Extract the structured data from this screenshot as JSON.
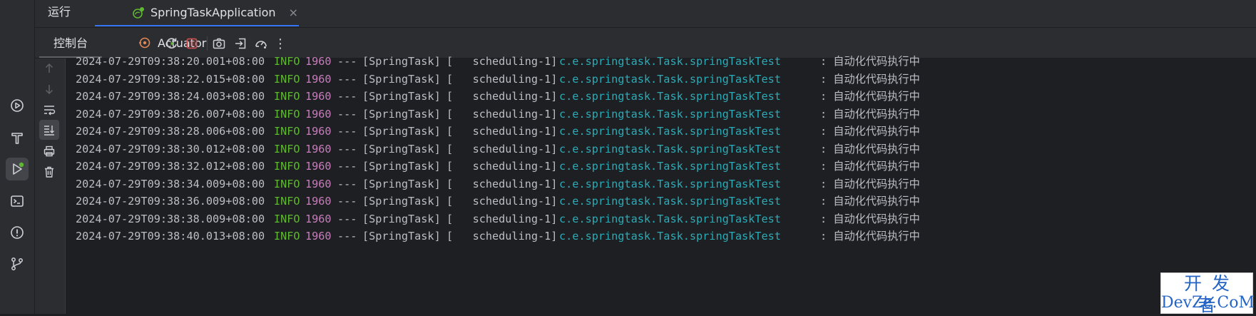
{
  "header": {
    "run_label": "运行",
    "app_tab": {
      "label": "SpringTaskApplication",
      "close": "×"
    }
  },
  "toolbar": {
    "console_tab": "控制台",
    "actuator_tab": "Actuator",
    "more": "⋮"
  },
  "left_strip_icons": [
    "services-icon",
    "build-icon",
    "run-icon",
    "terminal-icon",
    "problems-icon",
    "git-icon"
  ],
  "gutter_icons": [
    "scroll-up-icon",
    "scroll-down-icon",
    "soft-wrap-icon",
    "scroll-to-end-icon",
    "print-icon",
    "clear-icon"
  ],
  "console": {
    "lines": [
      {
        "ts": "2024-07-29T09:38:20.001+08:00",
        "level": "INFO",
        "pid": "1960",
        "sep": "---",
        "app": "[SpringTask]",
        "thread": "[   scheduling-1]",
        "logger": "c.e.springtask.Task.springTaskTest",
        "msg": ": 自动化代码执行中"
      },
      {
        "ts": "2024-07-29T09:38:22.015+08:00",
        "level": "INFO",
        "pid": "1960",
        "sep": "---",
        "app": "[SpringTask]",
        "thread": "[   scheduling-1]",
        "logger": "c.e.springtask.Task.springTaskTest",
        "msg": ": 自动化代码执行中"
      },
      {
        "ts": "2024-07-29T09:38:24.003+08:00",
        "level": "INFO",
        "pid": "1960",
        "sep": "---",
        "app": "[SpringTask]",
        "thread": "[   scheduling-1]",
        "logger": "c.e.springtask.Task.springTaskTest",
        "msg": ": 自动化代码执行中"
      },
      {
        "ts": "2024-07-29T09:38:26.007+08:00",
        "level": "INFO",
        "pid": "1960",
        "sep": "---",
        "app": "[SpringTask]",
        "thread": "[   scheduling-1]",
        "logger": "c.e.springtask.Task.springTaskTest",
        "msg": ": 自动化代码执行中"
      },
      {
        "ts": "2024-07-29T09:38:28.006+08:00",
        "level": "INFO",
        "pid": "1960",
        "sep": "---",
        "app": "[SpringTask]",
        "thread": "[   scheduling-1]",
        "logger": "c.e.springtask.Task.springTaskTest",
        "msg": ": 自动化代码执行中"
      },
      {
        "ts": "2024-07-29T09:38:30.012+08:00",
        "level": "INFO",
        "pid": "1960",
        "sep": "---",
        "app": "[SpringTask]",
        "thread": "[   scheduling-1]",
        "logger": "c.e.springtask.Task.springTaskTest",
        "msg": ": 自动化代码执行中"
      },
      {
        "ts": "2024-07-29T09:38:32.012+08:00",
        "level": "INFO",
        "pid": "1960",
        "sep": "---",
        "app": "[SpringTask]",
        "thread": "[   scheduling-1]",
        "logger": "c.e.springtask.Task.springTaskTest",
        "msg": ": 自动化代码执行中"
      },
      {
        "ts": "2024-07-29T09:38:34.009+08:00",
        "level": "INFO",
        "pid": "1960",
        "sep": "---",
        "app": "[SpringTask]",
        "thread": "[   scheduling-1]",
        "logger": "c.e.springtask.Task.springTaskTest",
        "msg": ": 自动化代码执行中"
      },
      {
        "ts": "2024-07-29T09:38:36.009+08:00",
        "level": "INFO",
        "pid": "1960",
        "sep": "---",
        "app": "[SpringTask]",
        "thread": "[   scheduling-1]",
        "logger": "c.e.springtask.Task.springTaskTest",
        "msg": ": 自动化代码执行中"
      },
      {
        "ts": "2024-07-29T09:38:38.009+08:00",
        "level": "INFO",
        "pid": "1960",
        "sep": "---",
        "app": "[SpringTask]",
        "thread": "[   scheduling-1]",
        "logger": "c.e.springtask.Task.springTaskTest",
        "msg": ": 自动化代码执行中"
      },
      {
        "ts": "2024-07-29T09:38:40.013+08:00",
        "level": "INFO",
        "pid": "1960",
        "sep": "---",
        "app": "[SpringTask]",
        "thread": "[   scheduling-1]",
        "logger": "c.e.springtask.Task.springTaskTest",
        "msg": ": 自动化代码执行中"
      }
    ]
  },
  "watermark": {
    "top": "开发者",
    "bottom": "DevZe.CoM"
  },
  "colors": {
    "accent": "#3574f0",
    "log_level": "#5fb832",
    "pid": "#c77dbb",
    "logger": "#2aacb8",
    "stop": "#c94f4f",
    "run_badge": "#5fb832"
  }
}
